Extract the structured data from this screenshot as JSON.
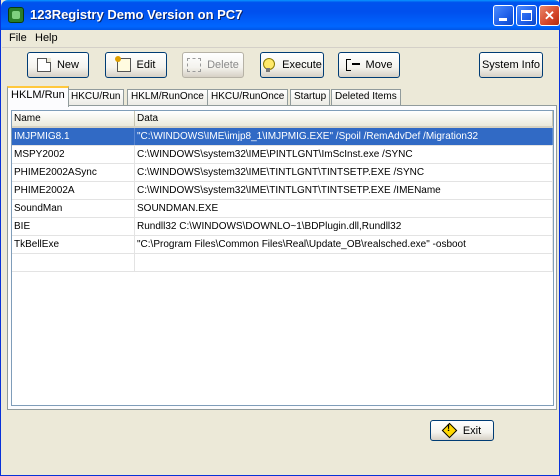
{
  "window": {
    "title": "123Registry Demo Version on  PC7"
  },
  "menu": {
    "file": "File",
    "help": "Help"
  },
  "toolbar": {
    "new": "New",
    "edit": "Edit",
    "delete": "Delete",
    "execute": "Execute",
    "move": "Move",
    "system_info": "System Info"
  },
  "tabs": [
    {
      "label": "HKLM/Run",
      "active": true
    },
    {
      "label": "HKCU/Run",
      "active": false
    },
    {
      "label": "HKLM/RunOnce",
      "active": false
    },
    {
      "label": "HKCU/RunOnce",
      "active": false
    },
    {
      "label": "Startup",
      "active": false
    },
    {
      "label": "Deleted Items",
      "active": false
    }
  ],
  "table": {
    "columns": [
      "Name",
      "Data"
    ],
    "rows": [
      {
        "name": "IMJPMIG8.1",
        "data": "\"C:\\WINDOWS\\IME\\imjp8_1\\IMJPMIG.EXE\" /Spoil /RemAdvDef /Migration32",
        "selected": true
      },
      {
        "name": "MSPY2002",
        "data": "C:\\WINDOWS\\system32\\IME\\PINTLGNT\\ImScInst.exe /SYNC",
        "selected": false
      },
      {
        "name": "PHIME2002ASync",
        "data": "C:\\WINDOWS\\system32\\IME\\TINTLGNT\\TINTSETP.EXE /SYNC",
        "selected": false
      },
      {
        "name": "PHIME2002A",
        "data": "C:\\WINDOWS\\system32\\IME\\TINTLGNT\\TINTSETP.EXE /IMEName",
        "selected": false
      },
      {
        "name": "SoundMan",
        "data": "SOUNDMAN.EXE",
        "selected": false
      },
      {
        "name": "BIE",
        "data": "Rundll32 C:\\WINDOWS\\DOWNLO~1\\BDPlugin.dll,Rundll32",
        "selected": false
      },
      {
        "name": "TkBellExe",
        "data": "\"C:\\Program Files\\Common Files\\Real\\Update_OB\\realsched.exe\"  -osboot",
        "selected": false
      },
      {
        "name": "",
        "data": "",
        "selected": false
      }
    ]
  },
  "footer": {
    "exit": "Exit"
  },
  "colors": {
    "selection": "#316ac5",
    "title_bar": "#0053ee",
    "active_tab_accent": "#ffc83c"
  }
}
